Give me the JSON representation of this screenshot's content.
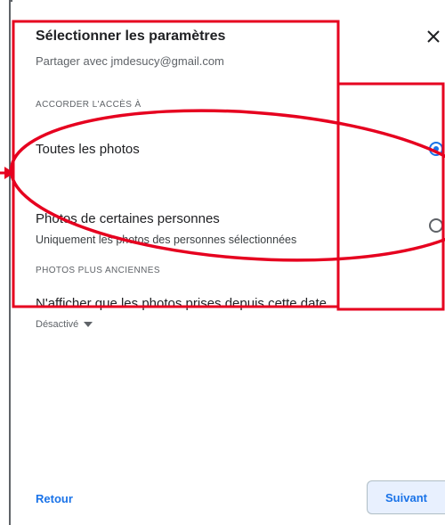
{
  "dialog": {
    "title": "Sélectionner les paramètres",
    "subtitle": "Partager avec jmdesucy@gmail.com",
    "close_icon": "close-icon"
  },
  "access": {
    "section_label": "ACCORDER L'ACCÈS À",
    "options": [
      {
        "label": "Toutes les photos",
        "selected": true
      },
      {
        "label": "Photos de certaines personnes",
        "description": "Uniquement les photos des personnes sélectionnées",
        "selected": false
      }
    ]
  },
  "older": {
    "section_label": "PHOTOS PLUS ANCIENNES",
    "title": "N'afficher que les photos prises depuis cette date",
    "dropdown_value": "Désactivé"
  },
  "footer": {
    "back_label": "Retour",
    "next_label": "Suivant"
  },
  "colors": {
    "accent": "#1a73e8",
    "annotation": "#e6001f"
  }
}
